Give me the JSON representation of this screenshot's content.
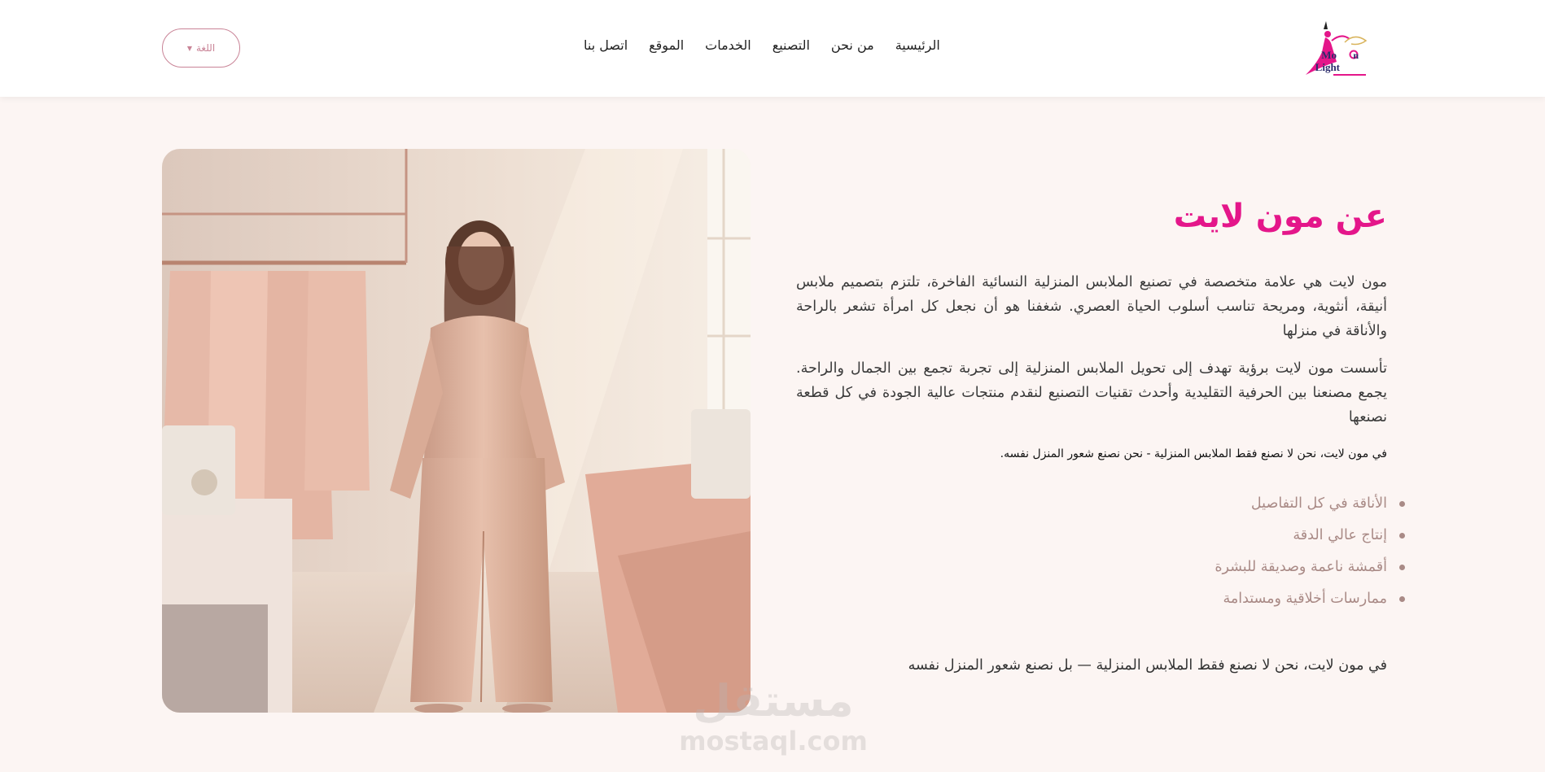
{
  "header": {
    "logo_text": "Moon Light",
    "nav": [
      "الرئيسية",
      "من نحن",
      "التصنيع",
      "الخدمات",
      "الموقع",
      "اتصل بنا"
    ],
    "language_label": "اللغة"
  },
  "about": {
    "title": "عن مون لايت",
    "paragraph_1": "مون لايت هي علامة متخصصة في تصنيع الملابس المنزلية النسائية الفاخرة، تلتزم بتصميم ملابس أنيقة، أنثوية، ومريحة تناسب أسلوب الحياة العصري. شغفنا هو أن نجعل كل امرأة تشعر بالراحة والأناقة في منزلها",
    "paragraph_2": "تأسست مون لايت برؤية تهدف إلى تحويل الملابس المنزلية إلى تجربة تجمع بين الجمال والراحة. يجمع مصنعنا بين الحرفية التقليدية وأحدث تقنيات التصنيع لنقدم منتجات عالية الجودة في كل قطعة نصنعها",
    "tagline": "في مون لايت، نحن لا نصنع فقط الملابس المنزلية - نحن نصنع شعور المنزل نفسه.",
    "features": [
      "الأناقة في كل التفاصيل",
      "إنتاج عالي الدقة",
      "أقمشة ناعمة وصديقة للبشرة",
      "ممارسات أخلاقية ومستدامة"
    ],
    "closing": "في مون لايت، نحن لا نصنع فقط الملابس المنزلية — بل نصنع شعور المنزل نفسه"
  },
  "watermark": {
    "arabic": "مستقل",
    "latin": "mostaql.com"
  },
  "colors": {
    "accent": "#e4168a",
    "page_bg": "#fcf5f3",
    "muted_text": "#a98a86",
    "lang_border": "#c98497"
  }
}
